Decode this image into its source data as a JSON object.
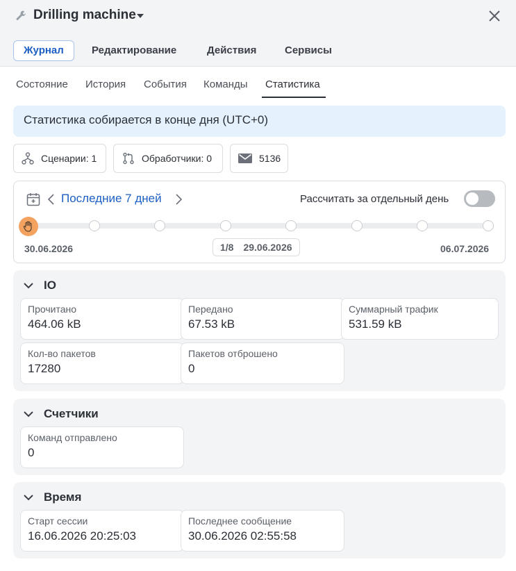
{
  "header": {
    "title": "Drilling machine",
    "icon": "wrench-icon"
  },
  "main_tabs": [
    {
      "label": "Журнал",
      "active": true
    },
    {
      "label": "Редактирование",
      "active": false
    },
    {
      "label": "Действия",
      "active": false
    },
    {
      "label": "Сервисы",
      "active": false
    }
  ],
  "sub_tabs": [
    {
      "label": "Состояние",
      "active": false
    },
    {
      "label": "История",
      "active": false
    },
    {
      "label": "События",
      "active": false
    },
    {
      "label": "Команды",
      "active": false
    },
    {
      "label": "Статистика",
      "active": true
    }
  ],
  "banner": {
    "text": "Статистика собирается в конце дня (UTC+0)"
  },
  "chips": {
    "scenarios": "Сценарии: 1",
    "handlers": "Обработчики: 0",
    "messages": "5136"
  },
  "date_range": {
    "label": "Последние 7 дней",
    "toggle_label": "Рассчитать за отдельный день",
    "toggle_on": false,
    "start": "30.06.2026",
    "end": "06.07.2026",
    "position": "1/8",
    "current": "29.06.2026",
    "step_count": 8,
    "selected_step": 1
  },
  "sections": {
    "io": {
      "title": "IO",
      "stats": [
        {
          "label": "Прочитано",
          "value": "464.06 kB"
        },
        {
          "label": "Передано",
          "value": "67.53 kB"
        },
        {
          "label": "Суммарный трафик",
          "value": "531.59 kB"
        },
        {
          "label": "Кол-во пакетов",
          "value": "17280"
        },
        {
          "label": "Пакетов отброшено",
          "value": "0"
        }
      ]
    },
    "counters": {
      "title": "Счетчики",
      "stats": [
        {
          "label": "Команд отправлено",
          "value": "0"
        }
      ]
    },
    "time": {
      "title": "Время",
      "stats": [
        {
          "label": "Старт сессии",
          "value": "16.06.2026 20:25:03"
        },
        {
          "label": "Последнее сообщение",
          "value": "30.06.2026 02:55:58"
        }
      ]
    }
  },
  "colors": {
    "accent": "#1d5fc4",
    "banner_bg": "#e5f1fc",
    "handle": "#f3a25f"
  }
}
